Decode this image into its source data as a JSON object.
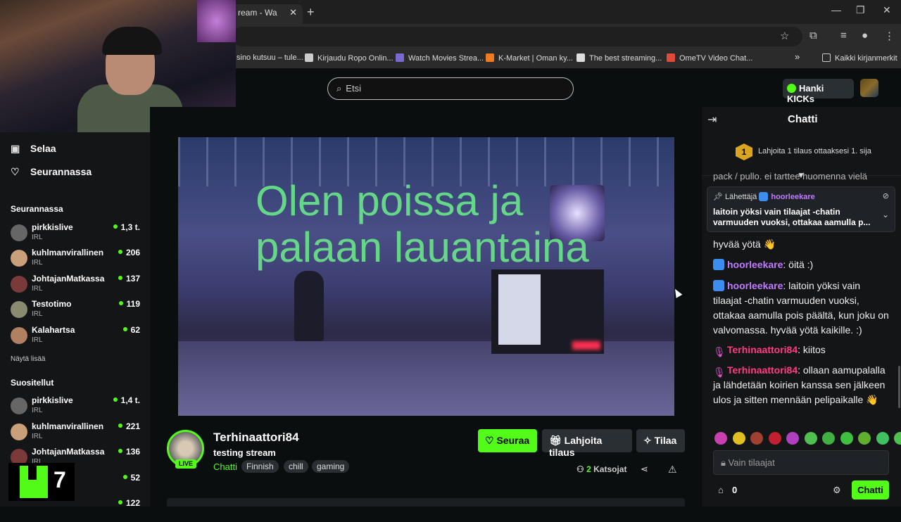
{
  "browser": {
    "tab_title": "ream - Wa",
    "bookmarks": [
      {
        "label": "sino kutsuu – tule...",
        "color": "#888"
      },
      {
        "label": "Kirjaudu Ropo Onlin...",
        "color": "#ccc"
      },
      {
        "label": "Watch Movies Strea...",
        "color": "#7a6ad0"
      },
      {
        "label": "K-Market | Oman ky...",
        "color": "#f07a20"
      },
      {
        "label": "The best streaming...",
        "color": "#ddd"
      },
      {
        "label": "OmeTV Video Chat...",
        "color": "#e04a3a"
      }
    ],
    "more_bookmarks": "»",
    "all_bookmarks": "Kaikki kirjanmerkit"
  },
  "header": {
    "search_placeholder": "Etsi",
    "kicks_button": "Hanki KICKs"
  },
  "sidebar": {
    "nav": [
      {
        "label": "Selaa",
        "icon": "browse-icon"
      },
      {
        "label": "Seurannassa",
        "icon": "heart-icon"
      }
    ],
    "following_title": "Seurannassa",
    "following": [
      {
        "name": "pirkkislive",
        "category": "IRL",
        "viewers": "1,3 t."
      },
      {
        "name": "kuhlmanvirallinen",
        "category": "IRL",
        "viewers": "206"
      },
      {
        "name": "JohtajanMatkassa",
        "category": "IRL",
        "viewers": "137"
      },
      {
        "name": "Testotimo",
        "category": "IRL",
        "viewers": "119"
      },
      {
        "name": "Kalahartsa",
        "category": "IRL",
        "viewers": "62"
      }
    ],
    "show_more": "Näytä lisää",
    "recommended_title": "Suositellut",
    "recommended": [
      {
        "name": "pirkkislive",
        "category": "IRL",
        "viewers": "1,4 t."
      },
      {
        "name": "kuhlmanvirallinen",
        "category": "IRL",
        "viewers": "221"
      },
      {
        "name": "JohtajanMatkassa",
        "category": "IRL",
        "viewers": "136"
      },
      {
        "name": "",
        "category": "",
        "viewers": "52"
      },
      {
        "name": "",
        "category": "",
        "viewers": "122"
      }
    ],
    "kick_badge_number": "7"
  },
  "player": {
    "overlay_line1": "Olen poissa ja",
    "overlay_line2": "palaan lauantaina"
  },
  "stream": {
    "streamer": "Terhinaattori84",
    "live_label": "LIVE",
    "title": "testing stream",
    "category": "Chatti",
    "tags": [
      "Finnish",
      "chill",
      "gaming"
    ],
    "follow": "Seuraa",
    "gift_sub": "Lahjoita tilaus",
    "subscribe": "Tilaa",
    "viewers_count": "2",
    "viewers_label": "Katsojat"
  },
  "chat": {
    "title": "Chatti",
    "leader_rank": "1",
    "leader_text": "Lahjoita 1 tilaus ottaaksesi 1. sija",
    "partial_top": "pack / pullo. ei tarttee huomenna vielä",
    "pinned_prefix": "Lähettäjä",
    "pinned_user": "hoorleekare",
    "pinned_message": "laitoin yöksi vain tilaajat -chatin varmuuden vuoksi, ottakaa aamulla p...",
    "messages": [
      {
        "user": "",
        "text": "hyvää yötä 👋"
      },
      {
        "user": "hoorleekare",
        "text": ": öitä :)"
      },
      {
        "user": "hoorleekare",
        "text": ": laitoin yöksi vain tilaajat -chatin varmuuden vuoksi, ottakaa aamulla pois päältä, kun joku on valvomassa. hyvää yötä kaikille. :)"
      },
      {
        "user": "Terhinaattori84",
        "text": ": kiitos"
      },
      {
        "user": "Terhinaattori84",
        "text": ": ollaan aamupalalla ja lähdetään koirien kanssa sen jälkeen ulos ja sitten mennään pelipaikalle 👋"
      }
    ],
    "input_placeholder": "Vain tilaajat",
    "kicks_balance": "0",
    "send_button": "Chatti",
    "emote_colors": [
      "#c83fb0",
      "#e0c020",
      "#a04030",
      "#c02030",
      "#b040c0",
      "#50c050",
      "#40b040",
      "#40c040",
      "#60b030",
      "#40c060",
      "#50c050"
    ]
  }
}
